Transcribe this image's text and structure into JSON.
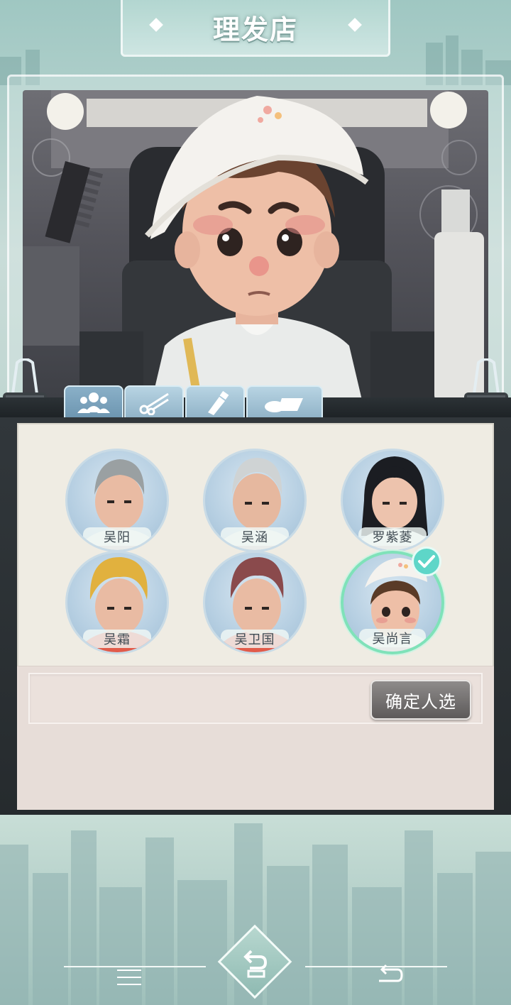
{
  "header": {
    "title": "理发店"
  },
  "tabs": [
    {
      "icon": "people-icon",
      "active": true
    },
    {
      "icon": "scissors-icon",
      "active": false
    },
    {
      "icon": "dye-bottle-icon",
      "active": false
    },
    {
      "icon": "eraser-icon",
      "active": false
    }
  ],
  "characters": [
    {
      "name": "吴阳",
      "hair": "#9aa0a2",
      "selected": false
    },
    {
      "name": "吴涵",
      "hair": "#cfd3d4",
      "selected": false
    },
    {
      "name": "罗紫菱",
      "hair": "#1b1d22",
      "selected": false
    },
    {
      "name": "吴霜",
      "hair": "#e1b13e",
      "selected": false
    },
    {
      "name": "吴卫国",
      "hair": "#8a4a4c",
      "selected": false
    },
    {
      "name": "吴尚言",
      "hair": "#5a3b27",
      "selected": true
    }
  ],
  "confirm": {
    "label": "确定人选"
  },
  "colors": {
    "accent_selected": "#7fe2b9",
    "check": "#5ed6c8",
    "button": "#6f6c6b"
  },
  "nav": {
    "menu_icon": "menu-icon",
    "back_icon": "back-arrow-icon",
    "return_icon": "return-icon"
  }
}
